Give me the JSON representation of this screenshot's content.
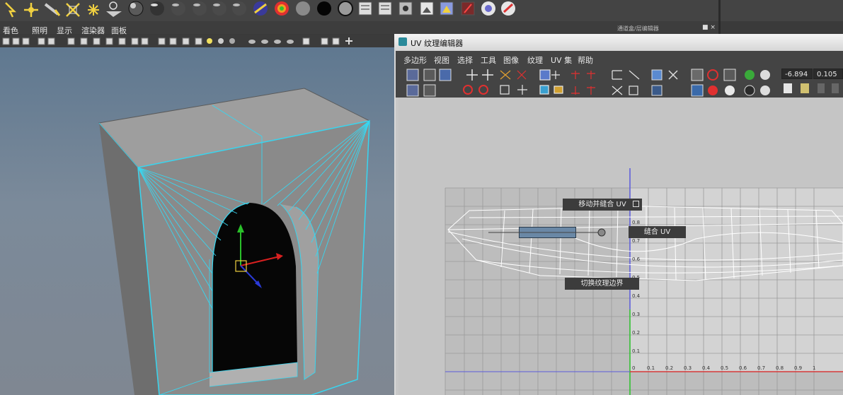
{
  "shelf": {
    "icons": [
      "select-tool-icon",
      "move-tool-icon",
      "lasso-tool-icon",
      "paint-tool-icon",
      "soft-select-icon",
      "show-manip-icon",
      "sphere-shader-icon",
      "sphere-dark-icon",
      "sphere-grey-icon",
      "sphere-grey2-icon",
      "sphere-grey3-icon",
      "sphere-blend-icon",
      "sphere-rainbow-icon",
      "swatch-grey-icon",
      "swatch-black-icon",
      "swatch-outline-icon",
      "render-clapper-icon",
      "render-clapper2-icon",
      "hypershade-icon",
      "render-view-icon",
      "render-settings-icon",
      "ipr-icon",
      "render-globe-icon",
      "render-brush-icon"
    ]
  },
  "viewport_menu": {
    "items": [
      "看色",
      "照明",
      "显示",
      "渲染器",
      "面板"
    ],
    "panel_label": "通道盒/层编辑器"
  },
  "uv_editor": {
    "title": "UV 纹理编辑器",
    "menu": [
      "多边形",
      "视图",
      "选择",
      "工具",
      "图像",
      "纹理",
      "UV 集",
      "帮助"
    ],
    "u_value": "-6.894",
    "v_value": "0.105",
    "tips": {
      "move_sew": "移动并缝合 UV",
      "sew": "缝合 UV",
      "toggle_border": "切换纹理边界"
    },
    "grid_labels": {
      "x_positive": [
        "0.1",
        "0.2",
        "0.3",
        "0.4",
        "0.5",
        "0.6",
        "0.7",
        "0.8",
        "0.9",
        "1"
      ],
      "y_positive": [
        "0.1",
        "0.2",
        "0.3",
        "0.4",
        "0.5",
        "0.6",
        "0.7",
        "0.8"
      ],
      "origin": "0"
    }
  },
  "colors": {
    "viewport_top": "#5f7890",
    "wire_cyan": "#38d6f0",
    "uv_blue_axis": "#5b5bdc",
    "uv_green_axis": "#29c229",
    "uv_red_axis": "#d83a3a"
  }
}
